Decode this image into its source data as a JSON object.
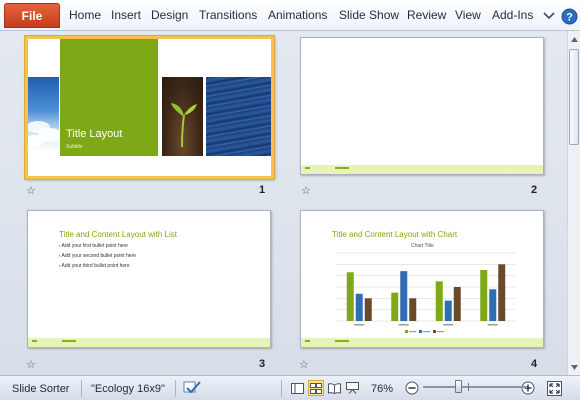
{
  "ribbon": {
    "file_label": "File",
    "tabs": [
      "Home",
      "Insert",
      "Design",
      "Transitions",
      "Animations",
      "Slide Show",
      "Review",
      "View",
      "Add-Ins"
    ],
    "icons": [
      "ribbon-minimize-icon",
      "help-icon"
    ]
  },
  "slides": [
    {
      "number": "1",
      "selected": true,
      "title": "Title Layout",
      "subtitle": "Subtitle",
      "images": [
        "sky-clouds-image",
        "sprout-image",
        "water-image"
      ],
      "accent": "#7fa816"
    },
    {
      "number": "2",
      "selected": false
    },
    {
      "number": "3",
      "selected": false,
      "title": "Title and Content Layout with List",
      "bullets": [
        "Add your first bullet point here",
        "Add your second bullet point here",
        "Add your third bullet point here"
      ]
    },
    {
      "number": "4",
      "selected": false,
      "title": "Title and Content Layout with Chart",
      "chart_title": "Chart Title"
    }
  ],
  "chart_data": {
    "type": "bar",
    "title": "Chart Title",
    "categories": [
      "",
      "",
      "",
      ""
    ],
    "series": [
      {
        "name": "",
        "color": "#7fa816",
        "values": [
          4.3,
          2.5,
          3.5,
          4.5
        ]
      },
      {
        "name": "",
        "color": "#2f6eb5",
        "values": [
          2.4,
          4.4,
          1.8,
          2.8
        ]
      },
      {
        "name": "",
        "color": "#6b4a2c",
        "values": [
          2.0,
          2.0,
          3.0,
          5.0
        ]
      }
    ],
    "ylim": [
      0,
      6
    ],
    "grid": true,
    "legend": "bottom"
  },
  "status": {
    "view_name": "Slide Sorter",
    "theme_name": "\"Ecology 16x9\"",
    "zoom": "76%",
    "zoom_level": 0.48,
    "icons": [
      "spell-check-icon",
      "normal-view-icon",
      "slide-sorter-icon",
      "reading-view-icon",
      "slide-show-icon",
      "zoom-out-icon",
      "zoom-in-icon",
      "fit-to-window-icon"
    ]
  },
  "colors": {
    "accent": "#7fa816",
    "selection": "#f2c44f",
    "file_tab": "#d24726"
  }
}
